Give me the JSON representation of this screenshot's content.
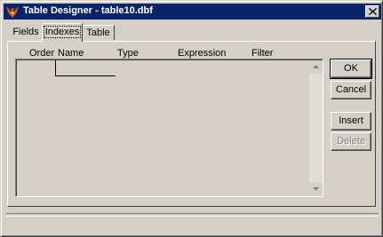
{
  "window": {
    "title": "Table Designer - table10.dbf",
    "close_label": "Close"
  },
  "tabs": [
    {
      "label": "Fields",
      "selected": false
    },
    {
      "label": "Indexes",
      "selected": true
    },
    {
      "label": "Table",
      "selected": false
    }
  ],
  "grid": {
    "columns": [
      "Order",
      "Name",
      "Type",
      "Expression",
      "Filter"
    ]
  },
  "buttons": {
    "ok": "OK",
    "cancel": "Cancel",
    "insert": "Insert",
    "delete": "Delete"
  },
  "colors": {
    "titlebar": "#0a246a",
    "face": "#d4d0c8"
  }
}
